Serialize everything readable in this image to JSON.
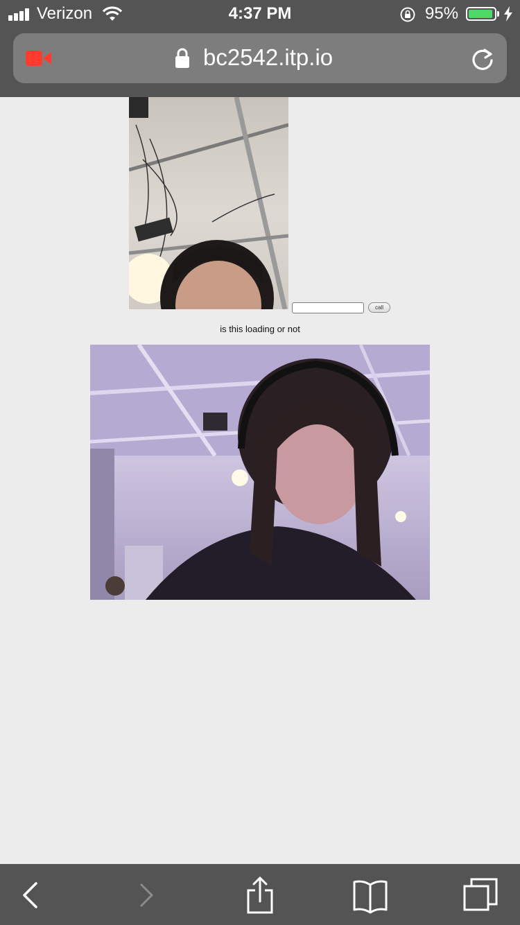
{
  "status_bar": {
    "carrier": "Verizon",
    "time": "4:37 PM",
    "battery_percent": "95%",
    "battery_level": 0.95,
    "icons": [
      "signal-icon",
      "wifi-icon",
      "orientation-lock-icon",
      "battery-icon",
      "charging-bolt-icon"
    ]
  },
  "browser": {
    "url": "bc2542.itp.io",
    "icons": [
      "camera-recording-icon",
      "lock-icon",
      "reload-icon"
    ]
  },
  "page": {
    "call_input_value": "",
    "call_button_label": "call",
    "loading_text": "is this loading or not",
    "videos": [
      "local-video",
      "remote-video"
    ]
  },
  "toolbar": {
    "icons": [
      "back-icon",
      "forward-icon",
      "share-icon",
      "bookmarks-icon",
      "tabs-icon"
    ]
  },
  "colors": {
    "chrome": "#545454",
    "url_field": "#7d7d7d",
    "page_bg": "#ececec",
    "recording_red": "#ff3b30",
    "battery_green": "#4cd964"
  }
}
